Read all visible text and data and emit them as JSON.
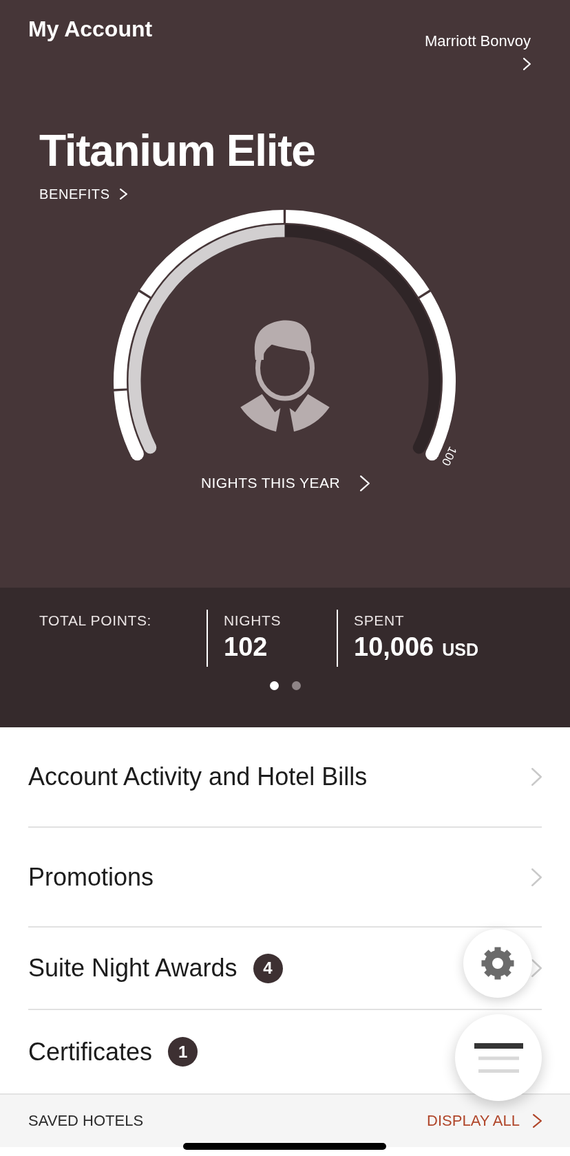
{
  "header": {
    "title": "My Account",
    "brand": "Marriott Bonvoy",
    "tier": "Titanium Elite",
    "benefits_link": "BENEFITS"
  },
  "gauge": {
    "level": 0.5,
    "max_label": "100",
    "caption": "NIGHTS THIS YEAR"
  },
  "stats": [
    {
      "label": "TOTAL POINTS:"
    },
    {
      "label": "NIGHTS",
      "value": "102"
    },
    {
      "label": "SPENT",
      "value": "10,006",
      "unit": "USD"
    }
  ],
  "pager": [
    {
      "selected": true
    },
    {
      "selected": false
    }
  ],
  "menu_items": [
    {
      "label": "Account Activity and Hotel Bills",
      "chevron": true
    },
    {
      "label": "Promotions",
      "chevron": true
    },
    {
      "label": "Suite Night Awards",
      "badge": "4",
      "chevron": true
    },
    {
      "label": "Certificates",
      "badge": "1",
      "chevron": false
    }
  ],
  "saved_hotels": {
    "label": "SAVED HOTELS",
    "link": "DISPLAY ALL"
  },
  "floating_buttons": [
    {
      "kind": "settings"
    },
    {
      "kind": "menu"
    }
  ]
}
